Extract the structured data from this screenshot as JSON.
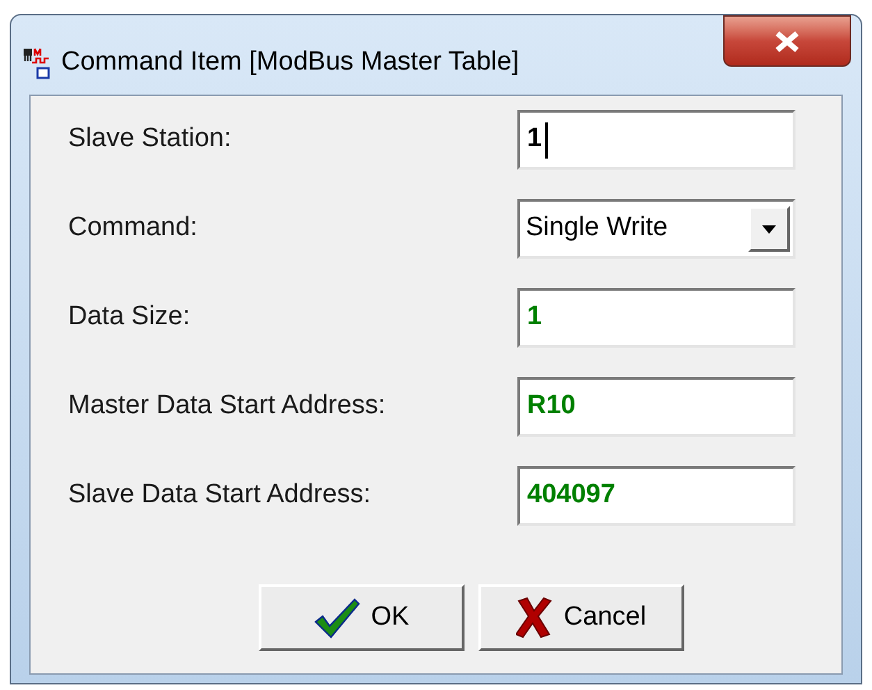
{
  "window": {
    "title": "Command Item [ModBus Master Table]"
  },
  "fields": [
    {
      "label": "Slave Station:",
      "kind": "text",
      "value": "1",
      "emphasized": false,
      "focused": true
    },
    {
      "label": "Command:",
      "kind": "dropdown",
      "value": "Single Write",
      "emphasized": false
    },
    {
      "label": "Data Size:",
      "kind": "text",
      "value": "1",
      "emphasized": true,
      "focused": false
    },
    {
      "label": "Master Data Start Address:",
      "kind": "text",
      "value": "R10",
      "emphasized": true,
      "focused": false
    },
    {
      "label": "Slave Data Start Address:",
      "kind": "text",
      "value": "404097",
      "emphasized": true,
      "focused": false
    }
  ],
  "buttons": [
    {
      "label": "OK",
      "kind": "ok"
    },
    {
      "label": "Cancel",
      "kind": "cancel"
    }
  ]
}
